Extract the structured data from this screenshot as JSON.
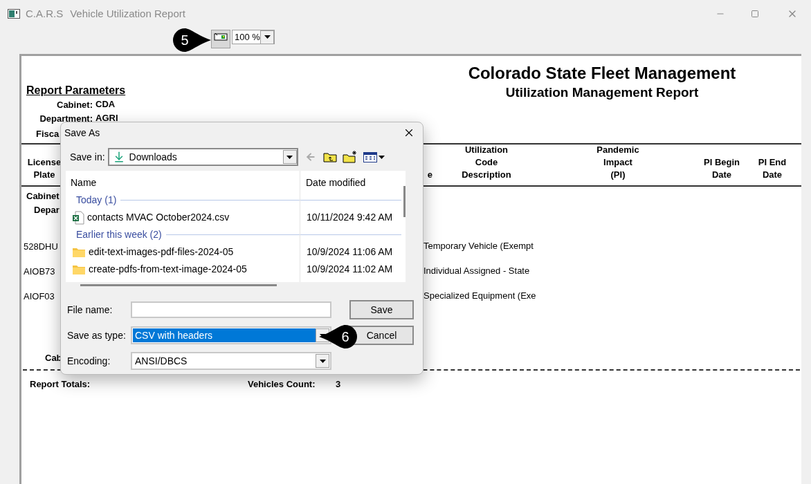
{
  "window": {
    "app_name": "C.A.R.S",
    "title": "Vehicle Utilization Report"
  },
  "toolbar": {
    "zoom": "100 %"
  },
  "callouts": [
    {
      "label": "5",
      "kind": "pointer-right"
    },
    {
      "label": "6",
      "kind": "pointer-left"
    }
  ],
  "report": {
    "title": "Colorado State Fleet Management",
    "subtitle": "Utilization Management Report",
    "parameters": {
      "heading": "Report Parameters",
      "lines": [
        {
          "label": "Cabinet:",
          "value": "CDA"
        },
        {
          "label": "Department:",
          "value": "AGRI"
        },
        {
          "label": "Fisca"
        }
      ]
    },
    "columns": [
      "License\nPlate",
      "e",
      "Utilization\nCode\nDescription",
      "Pandemic\nImpact\n(PI)",
      "PI Begin\nDate",
      "PI End\nDate"
    ],
    "groups": [
      "Cabinet",
      "Depar"
    ],
    "rows": [
      {
        "plate": "528DHU",
        "description": "Temporary Vehicle (Exempt"
      },
      {
        "plate": "AIOB73",
        "description": "Individual Assigned - State"
      },
      {
        "plate": "AIOF03",
        "description": "Specialized Equipment (Exe"
      }
    ],
    "footer_group": "Cab",
    "totals": {
      "label": "Report Totals:",
      "count_label": "Vehicles Count:",
      "count": "3"
    }
  },
  "dialog": {
    "title": "Save As",
    "save_in": {
      "label": "Save in:",
      "value": "Downloads"
    },
    "list": {
      "columns": [
        "Name",
        "Date modified"
      ],
      "groups": [
        {
          "label": "Today (1)",
          "items": [
            {
              "kind": "csv",
              "name": "contacts MVAC October2024.csv",
              "modified": "10/11/2024 9:42 AM"
            }
          ]
        },
        {
          "label": "Earlier this week (2)",
          "items": [
            {
              "kind": "folder",
              "name": "edit-text-images-pdf-files-2024-05",
              "modified": "10/9/2024 11:06 AM"
            },
            {
              "kind": "folder",
              "name": "create-pdfs-from-text-image-2024-05",
              "modified": "10/9/2024 11:02 AM"
            }
          ]
        }
      ]
    },
    "file_name": {
      "label": "File name:"
    },
    "save_as_type": {
      "label": "Save as type:",
      "value": "CSV with headers",
      "selected": true
    },
    "encoding": {
      "label": "Encoding:",
      "value": "ANSI/DBCS",
      "selected": false
    },
    "buttons": [
      "Save",
      "Cancel"
    ]
  }
}
